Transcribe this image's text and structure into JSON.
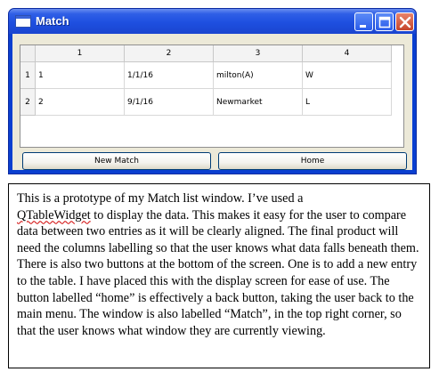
{
  "window": {
    "title": "Match"
  },
  "table": {
    "column_headers": [
      "1",
      "2",
      "3",
      "4"
    ],
    "row_headers": [
      "1",
      "2"
    ],
    "rows": [
      [
        "1",
        "1/1/16",
        "milton(A)",
        "W"
      ],
      [
        "2",
        "9/1/16",
        "Newmarket",
        "L"
      ]
    ]
  },
  "buttons": {
    "new_match": "New Match",
    "home": "Home"
  },
  "description": {
    "before_widget": "This is a prototype of my Match list window. I’ve used a",
    "widget_name": "QTableWidget",
    "after_widget": " to display the data. This makes it easy for the user to compare data between two entries as it will be clearly aligned. The final product will need the columns labelling so that the user knows what data falls beneath them. There is also two buttons at the bottom of the screen. One is to add a new entry to the table. I have placed this with the display screen for ease of use. The button labelled “home” is effectively a back button, taking the user back to the main menu. The window is also labelled “Match”, in the top right corner, so that the user knows what window they are currently viewing."
  }
}
